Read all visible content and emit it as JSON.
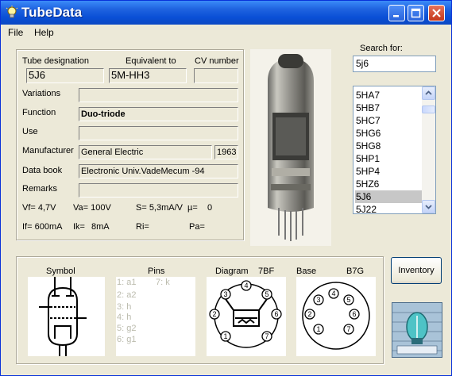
{
  "window": {
    "title": "TubeData"
  },
  "menu": {
    "file": "File",
    "help": "Help"
  },
  "labels": {
    "designation": "Tube designation",
    "equivalent": "Equivalent to",
    "cv": "CV number",
    "variations": "Variations",
    "function": "Function",
    "use": "Use",
    "manufacturer": "Manufacturer",
    "databook": "Data book",
    "remarks": "Remarks"
  },
  "fields": {
    "designation": "5J6",
    "equivalent": "5M-HH3",
    "cv": "",
    "variations": "",
    "function": "Duo-triode",
    "use": "",
    "manufacturer": "General Electric",
    "year": "1963",
    "databook": "Electronic Univ.VadeMecum -94",
    "remarks": ""
  },
  "params": {
    "vf": "Vf= 4,7V",
    "va": "Va= 100V",
    "s": "S= 5,3mA/V",
    "mu": "µ=",
    "mu_val": "0",
    "if": "If= 600mA",
    "ik": "Ik=",
    "ik_val": "8mA",
    "ri": "Ri=",
    "pa": "Pa="
  },
  "search": {
    "label": "Search for:",
    "value": "5j6"
  },
  "tube_list": [
    "5HA7",
    "5HB7",
    "5HC7",
    "5HG6",
    "5HG8",
    "5HP1",
    "5HP4",
    "5HZ6",
    "5J6",
    "5J22"
  ],
  "tube_list_selected": "5J6",
  "bottom": {
    "symbol": "Symbol",
    "pins": "Pins",
    "diagram": "Diagram",
    "diagram_code": "7BF",
    "base": "Base",
    "base_code": "B7G"
  },
  "pins_left": [
    "1: a1",
    "2: a2",
    "3: h",
    "4: h",
    "5: g2",
    "6: g1"
  ],
  "pins_right": [
    "7: k"
  ],
  "diagram_pins": [
    "1",
    "2",
    "3",
    "4",
    "5",
    "6",
    "7"
  ],
  "base_pins": [
    "1",
    "2",
    "3",
    "4",
    "5",
    "6",
    "7"
  ],
  "inventory_button": "Inventory",
  "colors": {
    "title_bar": "#0a4fd6",
    "window_bg": "#ece9d8",
    "selection": "#c7c7c7",
    "pin_text": "#bcbcae"
  },
  "icons": [
    "lightbulb-icon",
    "minimize-icon",
    "maximize-icon",
    "close-icon",
    "scroll-up-icon",
    "scroll-down-icon"
  ]
}
